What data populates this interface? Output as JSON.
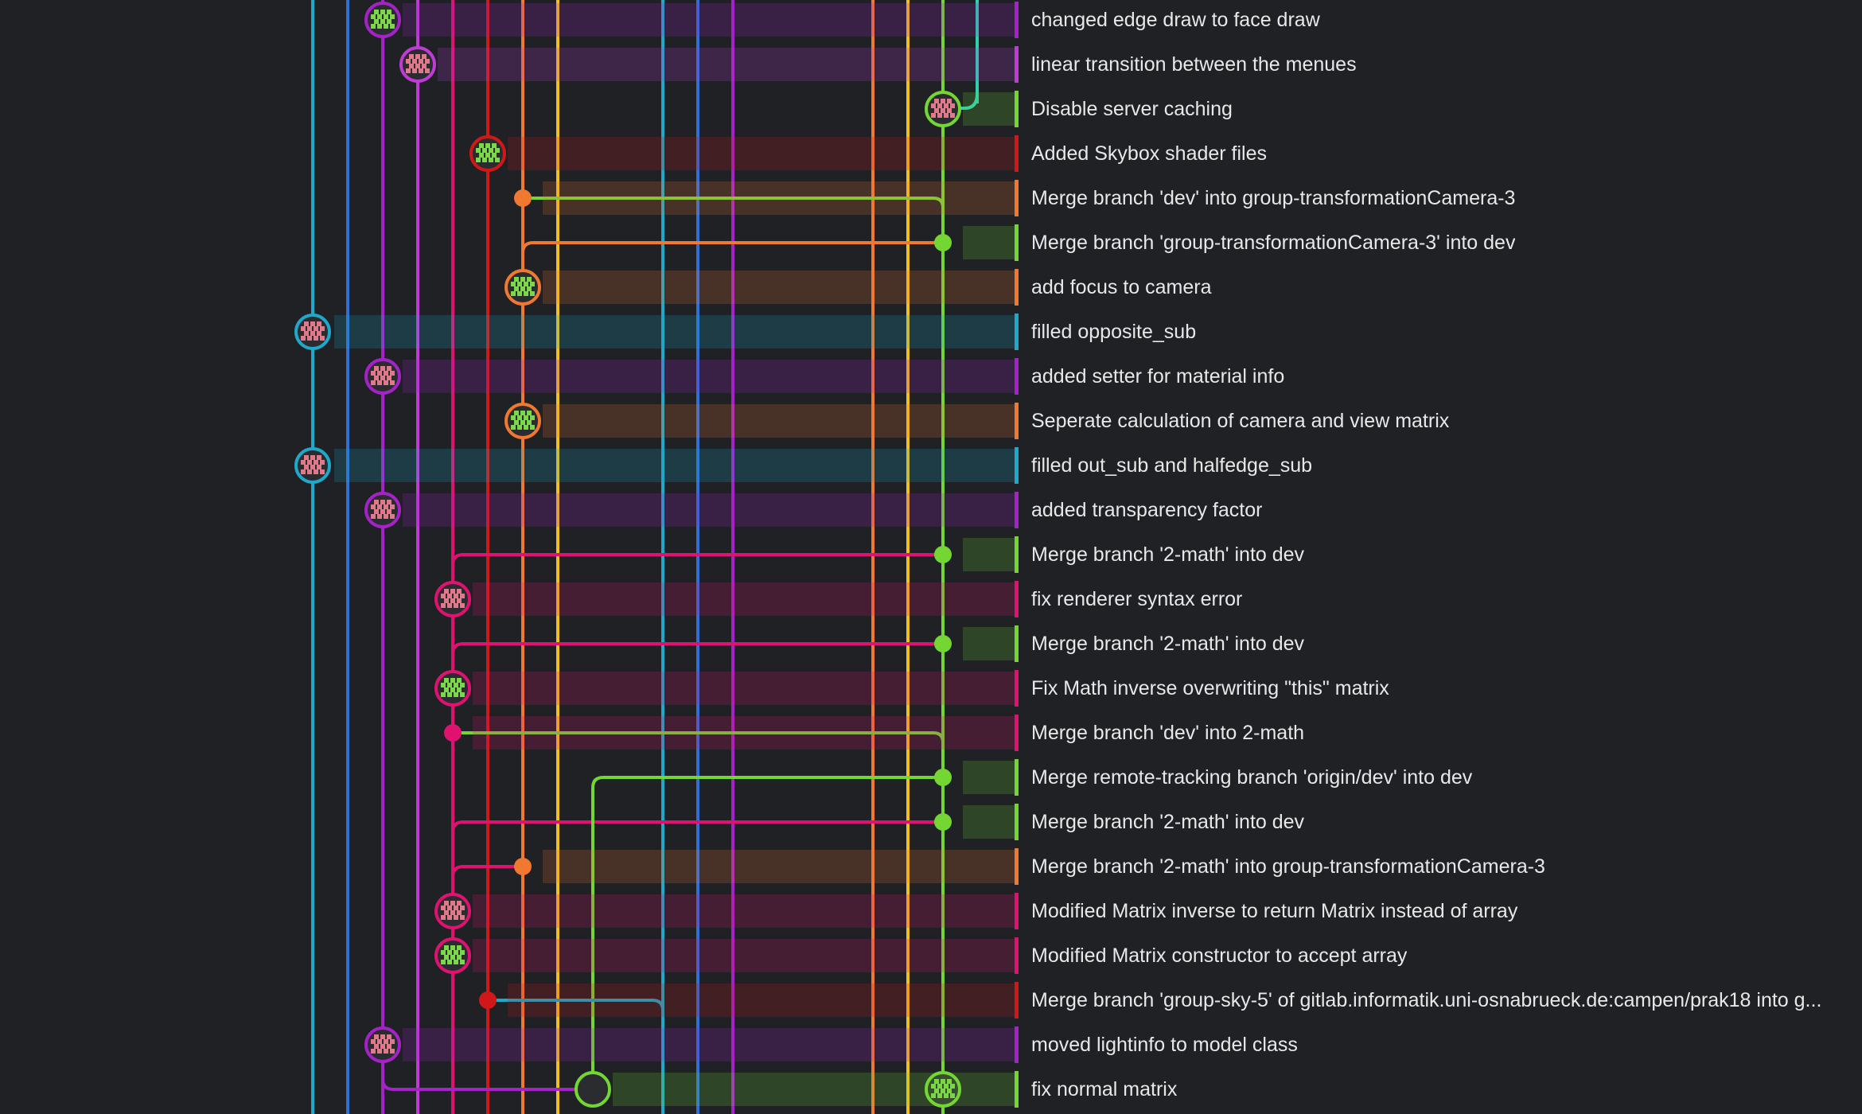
{
  "graph": {
    "lane_colors": [
      "#1fa8c9",
      "#2f6fd6",
      "#a422c8",
      "#c03ad6",
      "#e0126f",
      "#d01818",
      "#f07830",
      "#f0c020",
      "#1fa8c9",
      "#2f6fd6",
      "#a422c8",
      "#f07830",
      "#f0c020",
      "#74d633",
      "#2fd0b0"
    ],
    "branch_colors": {
      "cyan": "#1fa8c9",
      "purple": "#a422c8",
      "magenta": "#c03ad6",
      "pink": "#e0126f",
      "red": "#d01818",
      "orange": "#f07830",
      "green": "#74d633",
      "teal": "#2fd0b0"
    }
  },
  "commits": [
    {
      "message": "changed edge draw to face draw",
      "branch": "purple",
      "avatar": "avatar-icon"
    },
    {
      "message": "linear transition between the menues",
      "branch": "magenta",
      "avatar": "avatar-icon"
    },
    {
      "message": "Disable server caching",
      "branch": "green",
      "avatar": "avatar-icon"
    },
    {
      "message": "Added Skybox shader files",
      "branch": "red",
      "avatar": "avatar-icon"
    },
    {
      "message": "Merge branch 'dev' into group-transformationCamera-3",
      "branch": "orange",
      "avatar": "merge-dot"
    },
    {
      "message": "Merge branch 'group-transformationCamera-3' into dev",
      "branch": "green",
      "avatar": "merge-dot"
    },
    {
      "message": "add focus to camera",
      "branch": "orange",
      "avatar": "avatar-icon"
    },
    {
      "message": "filled opposite_sub",
      "branch": "cyan",
      "avatar": "avatar-icon"
    },
    {
      "message": "added setter for material info",
      "branch": "purple",
      "avatar": "avatar-icon"
    },
    {
      "message": "Seperate calculation of camera and view matrix",
      "branch": "orange",
      "avatar": "avatar-icon"
    },
    {
      "message": "filled out_sub and halfedge_sub",
      "branch": "cyan",
      "avatar": "avatar-icon"
    },
    {
      "message": "added transparency factor",
      "branch": "purple",
      "avatar": "avatar-icon"
    },
    {
      "message": "Merge branch '2-math' into dev",
      "branch": "green",
      "avatar": "merge-dot"
    },
    {
      "message": "fix renderer syntax error",
      "branch": "pink",
      "avatar": "avatar-icon"
    },
    {
      "message": "Merge branch '2-math' into dev",
      "branch": "green",
      "avatar": "merge-dot"
    },
    {
      "message": "Fix Math inverse overwriting \"this\" matrix",
      "branch": "pink",
      "avatar": "avatar-icon"
    },
    {
      "message": "Merge branch 'dev' into 2-math",
      "branch": "pink",
      "avatar": "merge-dot"
    },
    {
      "message": "Merge remote-tracking branch 'origin/dev' into dev",
      "branch": "green",
      "avatar": "merge-dot"
    },
    {
      "message": "Merge branch '2-math' into dev",
      "branch": "green",
      "avatar": "merge-dot"
    },
    {
      "message": "Merge branch '2-math' into group-transformationCamera-3",
      "branch": "orange",
      "avatar": "merge-dot"
    },
    {
      "message": "Modified Matrix inverse to return Matrix instead of array",
      "branch": "pink",
      "avatar": "avatar-icon"
    },
    {
      "message": "Modified Matrix constructor to accept array",
      "branch": "pink",
      "avatar": "avatar-icon"
    },
    {
      "message": "Merge branch 'group-sky-5' of gitlab.informatik.uni-osnabrueck.de:campen/prak18 into g...",
      "branch": "red",
      "avatar": "merge-dot"
    },
    {
      "message": "moved lightinfo to model class",
      "branch": "purple",
      "avatar": "avatar-icon"
    },
    {
      "message": "fix normal matrix",
      "branch": "green",
      "avatar": "avatar-icon"
    }
  ]
}
